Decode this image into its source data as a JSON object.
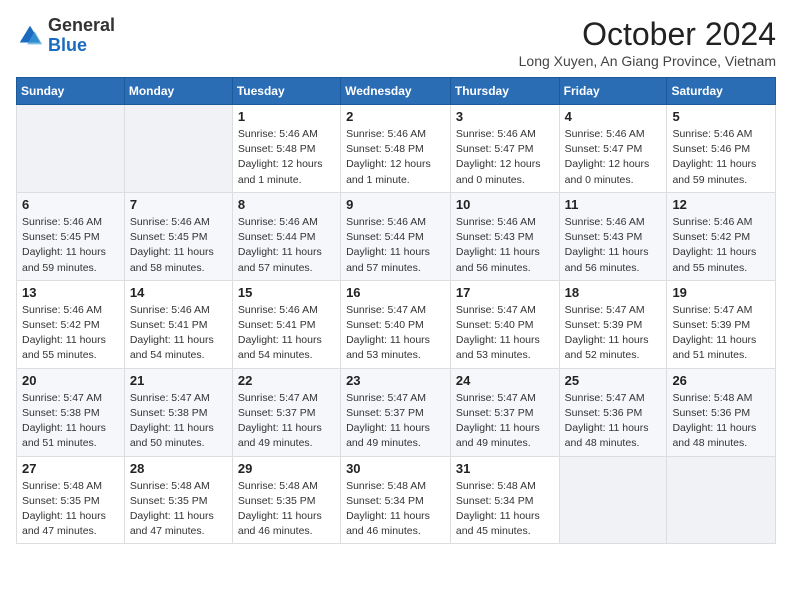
{
  "logo": {
    "general": "General",
    "blue": "Blue"
  },
  "header": {
    "month": "October 2024",
    "location": "Long Xuyen, An Giang Province, Vietnam"
  },
  "weekdays": [
    "Sunday",
    "Monday",
    "Tuesday",
    "Wednesday",
    "Thursday",
    "Friday",
    "Saturday"
  ],
  "weeks": [
    [
      {
        "day": "",
        "info": ""
      },
      {
        "day": "",
        "info": ""
      },
      {
        "day": "1",
        "info": "Sunrise: 5:46 AM\nSunset: 5:48 PM\nDaylight: 12 hours\nand 1 minute."
      },
      {
        "day": "2",
        "info": "Sunrise: 5:46 AM\nSunset: 5:48 PM\nDaylight: 12 hours\nand 1 minute."
      },
      {
        "day": "3",
        "info": "Sunrise: 5:46 AM\nSunset: 5:47 PM\nDaylight: 12 hours\nand 0 minutes."
      },
      {
        "day": "4",
        "info": "Sunrise: 5:46 AM\nSunset: 5:47 PM\nDaylight: 12 hours\nand 0 minutes."
      },
      {
        "day": "5",
        "info": "Sunrise: 5:46 AM\nSunset: 5:46 PM\nDaylight: 11 hours\nand 59 minutes."
      }
    ],
    [
      {
        "day": "6",
        "info": "Sunrise: 5:46 AM\nSunset: 5:45 PM\nDaylight: 11 hours\nand 59 minutes."
      },
      {
        "day": "7",
        "info": "Sunrise: 5:46 AM\nSunset: 5:45 PM\nDaylight: 11 hours\nand 58 minutes."
      },
      {
        "day": "8",
        "info": "Sunrise: 5:46 AM\nSunset: 5:44 PM\nDaylight: 11 hours\nand 57 minutes."
      },
      {
        "day": "9",
        "info": "Sunrise: 5:46 AM\nSunset: 5:44 PM\nDaylight: 11 hours\nand 57 minutes."
      },
      {
        "day": "10",
        "info": "Sunrise: 5:46 AM\nSunset: 5:43 PM\nDaylight: 11 hours\nand 56 minutes."
      },
      {
        "day": "11",
        "info": "Sunrise: 5:46 AM\nSunset: 5:43 PM\nDaylight: 11 hours\nand 56 minutes."
      },
      {
        "day": "12",
        "info": "Sunrise: 5:46 AM\nSunset: 5:42 PM\nDaylight: 11 hours\nand 55 minutes."
      }
    ],
    [
      {
        "day": "13",
        "info": "Sunrise: 5:46 AM\nSunset: 5:42 PM\nDaylight: 11 hours\nand 55 minutes."
      },
      {
        "day": "14",
        "info": "Sunrise: 5:46 AM\nSunset: 5:41 PM\nDaylight: 11 hours\nand 54 minutes."
      },
      {
        "day": "15",
        "info": "Sunrise: 5:46 AM\nSunset: 5:41 PM\nDaylight: 11 hours\nand 54 minutes."
      },
      {
        "day": "16",
        "info": "Sunrise: 5:47 AM\nSunset: 5:40 PM\nDaylight: 11 hours\nand 53 minutes."
      },
      {
        "day": "17",
        "info": "Sunrise: 5:47 AM\nSunset: 5:40 PM\nDaylight: 11 hours\nand 53 minutes."
      },
      {
        "day": "18",
        "info": "Sunrise: 5:47 AM\nSunset: 5:39 PM\nDaylight: 11 hours\nand 52 minutes."
      },
      {
        "day": "19",
        "info": "Sunrise: 5:47 AM\nSunset: 5:39 PM\nDaylight: 11 hours\nand 51 minutes."
      }
    ],
    [
      {
        "day": "20",
        "info": "Sunrise: 5:47 AM\nSunset: 5:38 PM\nDaylight: 11 hours\nand 51 minutes."
      },
      {
        "day": "21",
        "info": "Sunrise: 5:47 AM\nSunset: 5:38 PM\nDaylight: 11 hours\nand 50 minutes."
      },
      {
        "day": "22",
        "info": "Sunrise: 5:47 AM\nSunset: 5:37 PM\nDaylight: 11 hours\nand 49 minutes."
      },
      {
        "day": "23",
        "info": "Sunrise: 5:47 AM\nSunset: 5:37 PM\nDaylight: 11 hours\nand 49 minutes."
      },
      {
        "day": "24",
        "info": "Sunrise: 5:47 AM\nSunset: 5:37 PM\nDaylight: 11 hours\nand 49 minutes."
      },
      {
        "day": "25",
        "info": "Sunrise: 5:47 AM\nSunset: 5:36 PM\nDaylight: 11 hours\nand 48 minutes."
      },
      {
        "day": "26",
        "info": "Sunrise: 5:48 AM\nSunset: 5:36 PM\nDaylight: 11 hours\nand 48 minutes."
      }
    ],
    [
      {
        "day": "27",
        "info": "Sunrise: 5:48 AM\nSunset: 5:35 PM\nDaylight: 11 hours\nand 47 minutes."
      },
      {
        "day": "28",
        "info": "Sunrise: 5:48 AM\nSunset: 5:35 PM\nDaylight: 11 hours\nand 47 minutes."
      },
      {
        "day": "29",
        "info": "Sunrise: 5:48 AM\nSunset: 5:35 PM\nDaylight: 11 hours\nand 46 minutes."
      },
      {
        "day": "30",
        "info": "Sunrise: 5:48 AM\nSunset: 5:34 PM\nDaylight: 11 hours\nand 46 minutes."
      },
      {
        "day": "31",
        "info": "Sunrise: 5:48 AM\nSunset: 5:34 PM\nDaylight: 11 hours\nand 45 minutes."
      },
      {
        "day": "",
        "info": ""
      },
      {
        "day": "",
        "info": ""
      }
    ]
  ]
}
